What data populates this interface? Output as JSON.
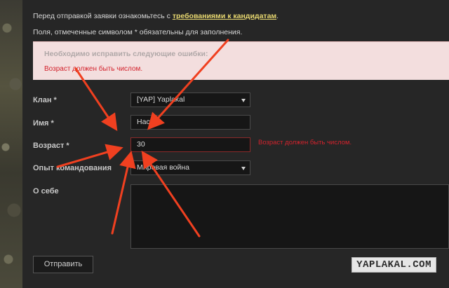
{
  "notice": {
    "prefix": "Перед отправкой заявки ознакомьтесь с ",
    "link": "требованиями к кандидатам",
    "suffix": ".",
    "required_note": "Поля, отмеченные символом * обязательны для заполнения."
  },
  "error_box": {
    "title": "Необходимо исправить следующие ошибки:",
    "message": "Возраст должен быть числом."
  },
  "form": {
    "clan_label": "Клан *",
    "clan_value": "[YAP] Yaplakal",
    "name_label": "Имя *",
    "name_value": "Настя",
    "age_label": "Возраст *",
    "age_value": "30",
    "age_error": "Возраст должен быть числом.",
    "experience_label": "Опыт командования",
    "experience_value": "Мировая война",
    "about_label": "О себе",
    "about_value": "",
    "submit_label": "Отправить"
  },
  "watermark": "YAPLAKAL.COM",
  "colors": {
    "error_red": "#d3232d",
    "arrow": "#f04020",
    "link_yellow": "#e8d870"
  }
}
